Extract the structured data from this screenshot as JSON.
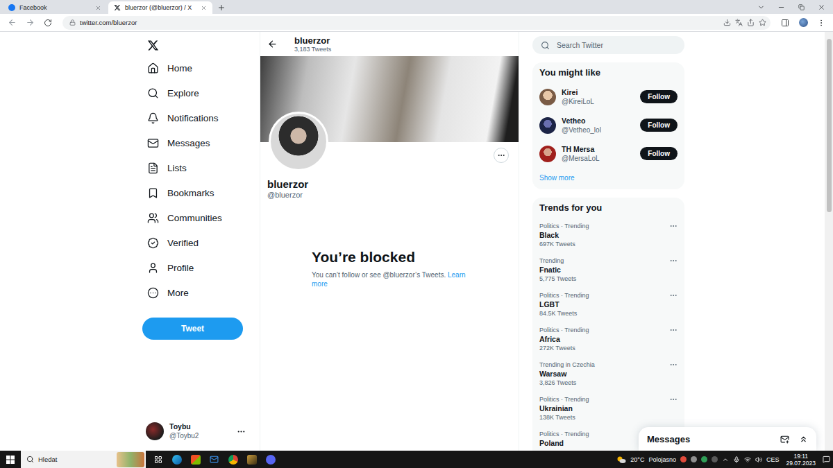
{
  "browser": {
    "tabs": [
      {
        "label": "Facebook",
        "selected": false
      },
      {
        "label": "bluerzor (@bluerzor) / X",
        "selected": true
      }
    ],
    "url": "twitter.com/bluerzor"
  },
  "nav": {
    "items": [
      {
        "label": "Home",
        "selected": false
      },
      {
        "label": "Explore",
        "selected": false
      },
      {
        "label": "Notifications",
        "selected": false
      },
      {
        "label": "Messages",
        "selected": false
      },
      {
        "label": "Lists",
        "selected": false
      },
      {
        "label": "Bookmarks",
        "selected": false
      },
      {
        "label": "Communities",
        "selected": false
      },
      {
        "label": "Verified",
        "selected": false
      },
      {
        "label": "Profile",
        "selected": false
      },
      {
        "label": "More",
        "selected": false
      }
    ],
    "tweet_button": "Tweet",
    "account": {
      "name": "Toybu",
      "handle": "@Toybu2"
    }
  },
  "profile": {
    "header_name": "bluerzor",
    "tweet_count": "3,183 Tweets",
    "name": "bluerzor",
    "handle": "@bluerzor",
    "blocked_title": "You’re blocked",
    "blocked_text": "You can’t follow or see @bluerzor’s Tweets.",
    "learn_more": "Learn more"
  },
  "search": {
    "placeholder": "Search Twitter"
  },
  "who_to_follow": {
    "title": "You might like",
    "users": [
      {
        "name": "Kirei",
        "handle": "@KireiLoL",
        "button": "Follow"
      },
      {
        "name": "Vetheo",
        "handle": "@Vetheo_lol",
        "button": "Follow"
      },
      {
        "name": "TH Mersa",
        "handle": "@MersaLoL",
        "button": "Follow"
      }
    ],
    "show_more": "Show more"
  },
  "trends": {
    "title": "Trends for you",
    "items": [
      {
        "context": "Politics · Trending",
        "name": "Black",
        "count": "697K Tweets"
      },
      {
        "context": "Trending",
        "name": "Fnatic",
        "count": "5,775 Tweets"
      },
      {
        "context": "Politics · Trending",
        "name": "LGBT",
        "count": "84.5K Tweets"
      },
      {
        "context": "Politics · Trending",
        "name": "Africa",
        "count": "272K Tweets"
      },
      {
        "context": "Trending in Czechia",
        "name": "Warsaw",
        "count": "3,826 Tweets"
      },
      {
        "context": "Politics · Trending",
        "name": "Ukrainian",
        "count": "138K Tweets"
      },
      {
        "context": "Politics · Trending",
        "name": "Poland"
      }
    ]
  },
  "messages_drawer": {
    "title": "Messages"
  },
  "taskbar": {
    "search": "Hledat",
    "temperature": "20°C",
    "condition": "Polojasno",
    "language": "CES",
    "time": "19:11",
    "date": "29.07.2023"
  }
}
